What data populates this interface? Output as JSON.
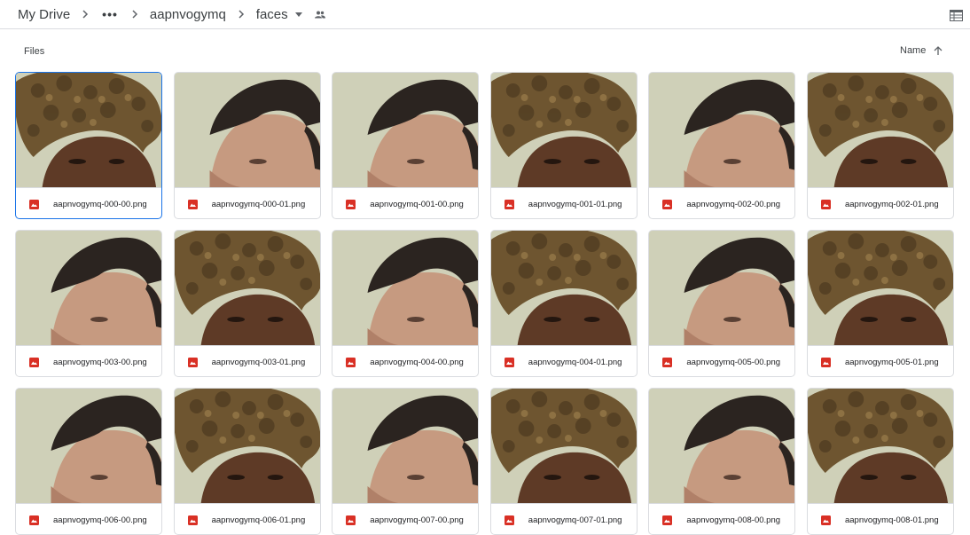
{
  "breadcrumb": {
    "root": "My Drive",
    "ellipsis": "•••",
    "parent": "aapnvogymq",
    "current": "faces"
  },
  "section": {
    "label": "Files",
    "sort_label": "Name"
  },
  "files": [
    {
      "name": "aapnvogymq-000-00.png",
      "subject": "curly",
      "selected": true
    },
    {
      "name": "aapnvogymq-000-01.png",
      "subject": "man"
    },
    {
      "name": "aapnvogymq-001-00.png",
      "subject": "man"
    },
    {
      "name": "aapnvogymq-001-01.png",
      "subject": "curly"
    },
    {
      "name": "aapnvogymq-002-00.png",
      "subject": "man"
    },
    {
      "name": "aapnvogymq-002-01.png",
      "subject": "curly"
    },
    {
      "name": "aapnvogymq-003-00.png",
      "subject": "man"
    },
    {
      "name": "aapnvogymq-003-01.png",
      "subject": "curly"
    },
    {
      "name": "aapnvogymq-004-00.png",
      "subject": "man"
    },
    {
      "name": "aapnvogymq-004-01.png",
      "subject": "curly"
    },
    {
      "name": "aapnvogymq-005-00.png",
      "subject": "man"
    },
    {
      "name": "aapnvogymq-005-01.png",
      "subject": "curly"
    },
    {
      "name": "aapnvogymq-006-00.png",
      "subject": "man"
    },
    {
      "name": "aapnvogymq-006-01.png",
      "subject": "curly"
    },
    {
      "name": "aapnvogymq-007-00.png",
      "subject": "man"
    },
    {
      "name": "aapnvogymq-007-01.png",
      "subject": "curly"
    },
    {
      "name": "aapnvogymq-008-00.png",
      "subject": "man"
    },
    {
      "name": "aapnvogymq-008-01.png",
      "subject": "curly"
    }
  ],
  "colors": {
    "accent": "#1a73e8",
    "image_icon": "#d93025",
    "background_wall": "#cfd0b8",
    "skin_light": "#c69a80",
    "skin_dark": "#5e3a26",
    "hair_dark": "#2b2420",
    "hair_curly": "#6e5530"
  }
}
